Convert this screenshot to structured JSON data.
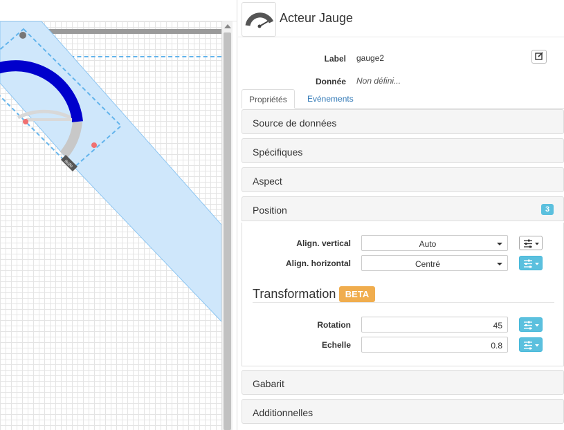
{
  "actor": {
    "title": "Acteur Jauge",
    "icon": "gauge-icon"
  },
  "fields": {
    "label": {
      "label": "Label",
      "value": "gauge2"
    },
    "data": {
      "label": "Donnée",
      "value": "Non défini..."
    }
  },
  "tabs": [
    {
      "label": "Propriétés",
      "active": true
    },
    {
      "label": "Evénements",
      "active": false
    }
  ],
  "sections": {
    "data_source": "Source de données",
    "specific": "Spécifiques",
    "aspect": "Aspect",
    "position": {
      "title": "Position",
      "badge": "3"
    },
    "template": "Gabarit",
    "additional": "Additionnelles"
  },
  "position": {
    "valign": {
      "label": "Align. vertical",
      "value": "Auto"
    },
    "halign": {
      "label": "Align. horizontal",
      "value": "Centré"
    }
  },
  "transformation": {
    "title": "Transformation",
    "badge": "BETA",
    "rotation": {
      "label": "Rotation",
      "value": "45"
    },
    "scale": {
      "label": "Echelle",
      "value": "0.8"
    }
  },
  "canvas": {
    "widget_tag": "auto"
  },
  "colors": {
    "accent": "#5bc0de",
    "beta": "#f0ad4e",
    "gauge_fill": "#0000cc",
    "selection": "#63b4ec"
  }
}
